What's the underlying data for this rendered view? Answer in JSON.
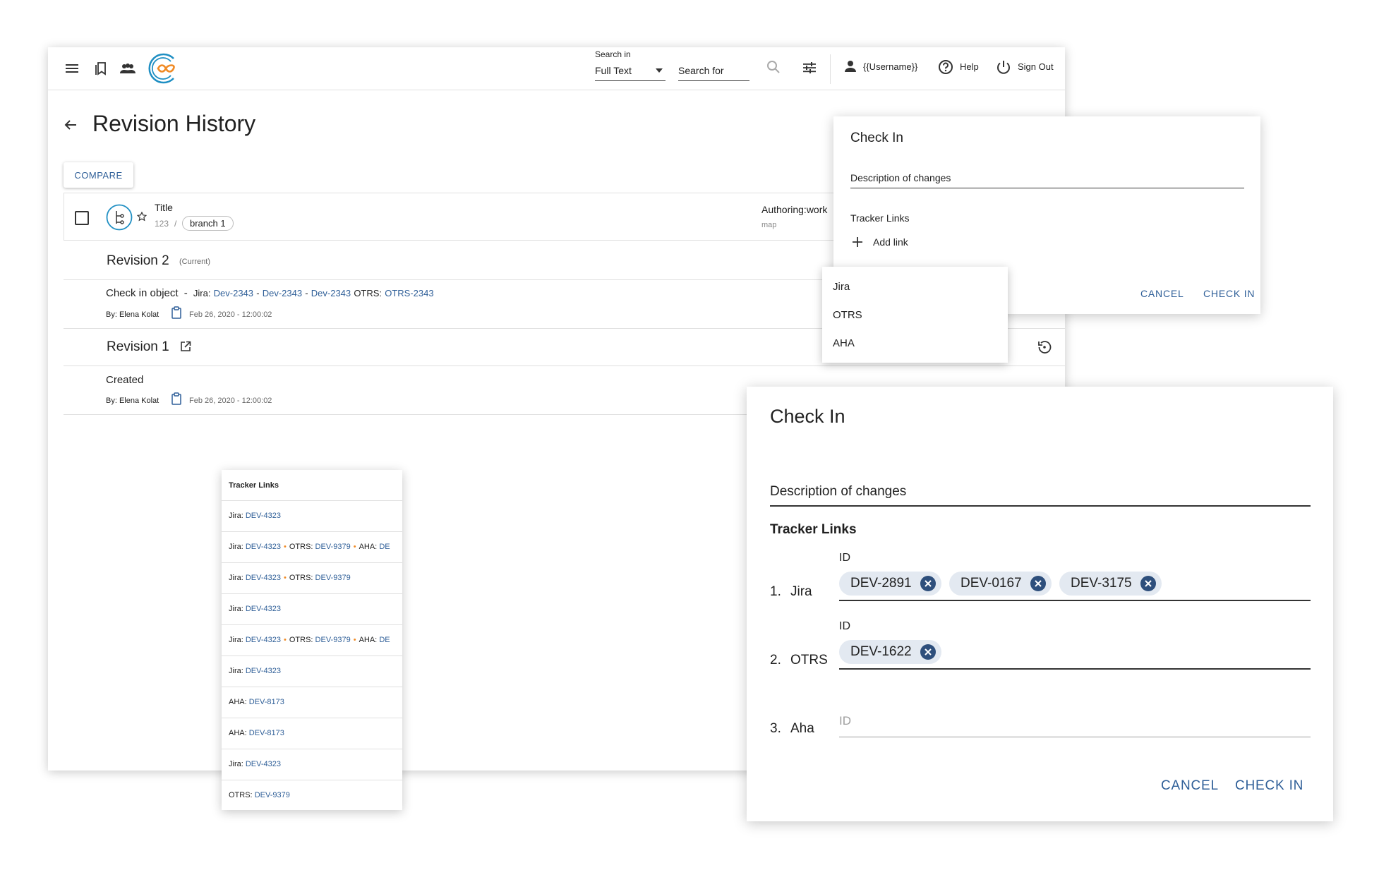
{
  "topbar": {
    "search_in_label": "Search in",
    "search_in_value": "Full Text",
    "search_placeholder": "Search for",
    "username": "{{Username}}",
    "help": "Help",
    "sign_out": "Sign Out"
  },
  "page": {
    "title": "Revision History",
    "compare_button": "COMPARE"
  },
  "object": {
    "title": "Title",
    "id": "123",
    "sep": "/",
    "branch": "branch 1",
    "authoring": "Authoring:work",
    "type": "map"
  },
  "revisions": [
    {
      "name": "Revision 2",
      "tag": "(Current)",
      "event": "Check in object",
      "dash": "-",
      "jira_label": "Jira:",
      "jira_links": [
        "Dev-2343",
        "Dev-2343",
        "Dev-2343"
      ],
      "link_sep": "-",
      "otrs_label": "OTRS:",
      "otrs_link": "OTRS-2343",
      "by": "By: Elena Kolat",
      "date": "Feb 26, 2020 - 12:00:02"
    },
    {
      "name": "Revision 1",
      "event": "Created",
      "by": "By: Elena Kolat",
      "date": "Feb 26, 2020 - 12:00:02"
    }
  ],
  "check_in_small": {
    "title": "Check In",
    "description_label": "Description of changes",
    "tracker_links": "Tracker Links",
    "add_link": "Add link",
    "cancel": "CANCEL",
    "check_in": "CHECK IN"
  },
  "add_link_menu": [
    "Jira",
    "OTRS",
    "AHA"
  ],
  "tracker_links_list": {
    "header": "Tracker Links",
    "rows": [
      [
        {
          "label": "Jira:",
          "id": "DEV-4323"
        }
      ],
      [
        {
          "label": "Jira:",
          "id": "DEV-4323"
        },
        {
          "label": "OTRS:",
          "id": "DEV-9379"
        },
        {
          "label": "AHA:",
          "id": "DE"
        }
      ],
      [
        {
          "label": "Jira:",
          "id": "DEV-4323"
        },
        {
          "label": "OTRS:",
          "id": "DEV-9379"
        }
      ],
      [
        {
          "label": "Jira:",
          "id": "DEV-4323"
        }
      ],
      [
        {
          "label": "Jira:",
          "id": "DEV-4323"
        },
        {
          "label": "OTRS:",
          "id": "DEV-9379"
        },
        {
          "label": "AHA:",
          "id": "DE"
        }
      ],
      [
        {
          "label": "Jira:",
          "id": "DEV-4323"
        }
      ],
      [
        {
          "label": "AHA:",
          "id": "DEV-8173"
        }
      ],
      [
        {
          "label": "AHA:",
          "id": "DEV-8173"
        }
      ],
      [
        {
          "label": "Jira:",
          "id": "DEV-4323"
        }
      ],
      [
        {
          "label": "OTRS:",
          "id": "DEV-9379"
        }
      ]
    ]
  },
  "check_in_large": {
    "title": "Check In",
    "description_label": "Description of changes",
    "tracker_links": "Tracker Links",
    "trackers": [
      {
        "number": "1.",
        "name": "Jira",
        "field_label": "ID",
        "chips": [
          "DEV-2891",
          "DEV-0167",
          "DEV-3175"
        ]
      },
      {
        "number": "2.",
        "name": "OTRS",
        "field_label": "ID",
        "chips": [
          "DEV-1622"
        ]
      },
      {
        "number": "3.",
        "name": "Aha",
        "placeholder": "ID",
        "chips": []
      }
    ],
    "cancel": "CANCEL",
    "check_in": "CHECK IN"
  },
  "colors": {
    "accent": "#2f5f98",
    "chip_bg": "#e3e9f1",
    "chip_close": "#2e4f7c",
    "logo_blue": "#1f8fc3",
    "logo_orange": "#f08a24",
    "dot_orange": "#f08a24"
  }
}
